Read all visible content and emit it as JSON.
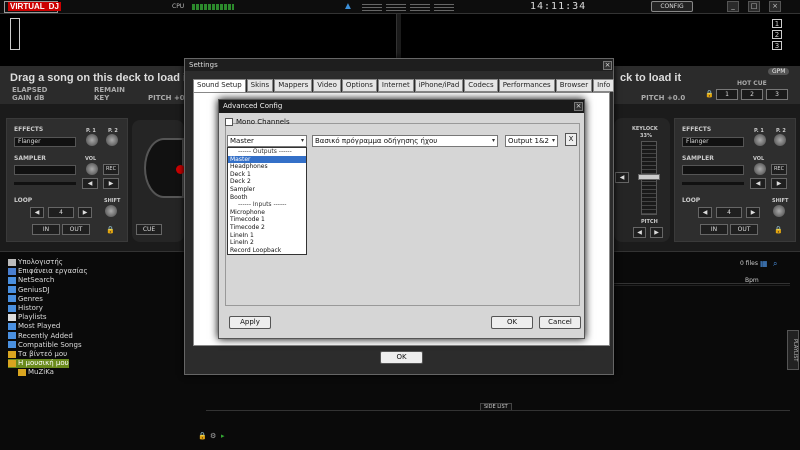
{
  "app": {
    "logo_text": "VIRTUAL",
    "logo_badge": "DJ",
    "cpu_label": "CPU",
    "clock": "14:11:34",
    "config_label": "CONFIG"
  },
  "window_controls": [
    "_",
    "□",
    "×"
  ],
  "deck_numbers": [
    "1",
    "2",
    "3"
  ],
  "deck_left": {
    "drag_text": "Drag a song on this deck to load it",
    "elapsed": "ELAPSED",
    "gain": "GAIN dB",
    "remain": "REMAIN",
    "key": "KEY",
    "pitch": "PITCH +0.0"
  },
  "deck_right": {
    "drag_text": "ck to load it",
    "pitch": "PITCH +0.0",
    "gpm": "GPM",
    "hot_cue": "HOT CUE",
    "hot_cue_buttons": [
      "1",
      "2",
      "3"
    ]
  },
  "panel_left": {
    "effects": "EFFECTS",
    "p1": "P. 1",
    "p2": "P. 2",
    "effect_value": "Flanger",
    "sampler": "SAMPLER",
    "vol": "VOL",
    "rec": "REC",
    "loop": "LOOP",
    "shift": "SHIFT",
    "loop_value": "4",
    "in": "IN",
    "out": "OUT",
    "cue": "CUE"
  },
  "panel_right": {
    "effects": "EFFECTS",
    "p1": "P. 1",
    "p2": "P. 2",
    "effect_value": "Flanger",
    "sampler": "SAMPLER",
    "vol": "VOL",
    "rec": "REC",
    "loop": "LOOP",
    "shift": "SHIFT",
    "loop_value": "4",
    "in": "IN",
    "out": "OUT",
    "keylock": "KEYLOCK",
    "keylock_pct": "33%",
    "pitch": "PITCH"
  },
  "browser": {
    "tree": [
      {
        "label": "Υπολογιστής",
        "indent": 0,
        "color": "#bbbbbb"
      },
      {
        "label": "Επιφάνεια εργασίας",
        "indent": 0,
        "color": "#4a7fd0"
      },
      {
        "label": "NetSearch",
        "indent": 0,
        "color": "#4a90e0"
      },
      {
        "label": "GeniusDJ",
        "indent": 0,
        "color": "#4a90e0"
      },
      {
        "label": "Genres",
        "indent": 0,
        "color": "#4a90e0"
      },
      {
        "label": "History",
        "indent": 0,
        "color": "#4a90e0"
      },
      {
        "label": "Playlists",
        "indent": 0,
        "color": "#dddddd"
      },
      {
        "label": "Most Played",
        "indent": 0,
        "color": "#4a90e0"
      },
      {
        "label": "Recently Added",
        "indent": 0,
        "color": "#4a90e0"
      },
      {
        "label": "Compatible Songs",
        "indent": 0,
        "color": "#4a90e0"
      },
      {
        "label": "Τα βίντεό μου",
        "indent": 0,
        "color": "#d9a520"
      },
      {
        "label": "Η μουσική μου",
        "indent": 0,
        "color": "#d9a520",
        "selected": true
      },
      {
        "label": "MuZiKa",
        "indent": 1,
        "color": "#d9a520"
      }
    ],
    "files_count": "0 files",
    "bpm_header": "Bpm",
    "side_list": "SIDE LIST",
    "playlist_tab": "PLAYLIST"
  },
  "settings": {
    "title": "Settings",
    "close": "×",
    "tabs": [
      "Sound Setup",
      "Skins",
      "Mappers",
      "Video",
      "Options",
      "Internet",
      "iPhone/iPad",
      "Codecs",
      "Performances",
      "Browser",
      "Info"
    ],
    "active_tab": "Sound Setup",
    "ok_label": "OK"
  },
  "advanced": {
    "title": "Advanced Config",
    "close": "×",
    "mono_label": "Mono Channels",
    "channel_select": "Master",
    "driver_select": "Βασικό πρόγραμμα οδήγησης ήχου",
    "output_select": "Output 1&2",
    "remove_label": "X",
    "options": [
      {
        "label": "------ Outputs ------",
        "header": true
      },
      {
        "label": "Master",
        "highlighted": true
      },
      {
        "label": "Headphones"
      },
      {
        "label": "Deck 1"
      },
      {
        "label": "Deck 2"
      },
      {
        "label": "Sampler"
      },
      {
        "label": "Booth"
      },
      {
        "label": "------ Inputs ------",
        "header": true
      },
      {
        "label": "Microphone"
      },
      {
        "label": "Timecode 1"
      },
      {
        "label": "Timecode 2"
      },
      {
        "label": "LineIn 1"
      },
      {
        "label": "LineIn 2"
      },
      {
        "label": "Record Loopback"
      }
    ],
    "apply_label": "Apply",
    "ok_label": "OK",
    "cancel_label": "Cancel"
  }
}
